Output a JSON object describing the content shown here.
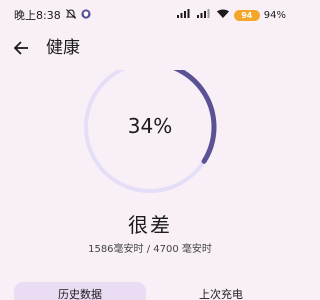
{
  "status_bar": {
    "time": "晚上8:38",
    "battery_percent": "94%",
    "battery_level": "94"
  },
  "header": {
    "title": "健康"
  },
  "gauge": {
    "value_text": "34%",
    "value": 0.34,
    "track_color": "#e5def7",
    "progress_color": "#5b5295"
  },
  "health": {
    "status": "很差",
    "capacity": "1586毫安时 / 4700 毫安时"
  },
  "tabs": [
    {
      "label": "历史数据"
    },
    {
      "label": "上次充电"
    }
  ]
}
